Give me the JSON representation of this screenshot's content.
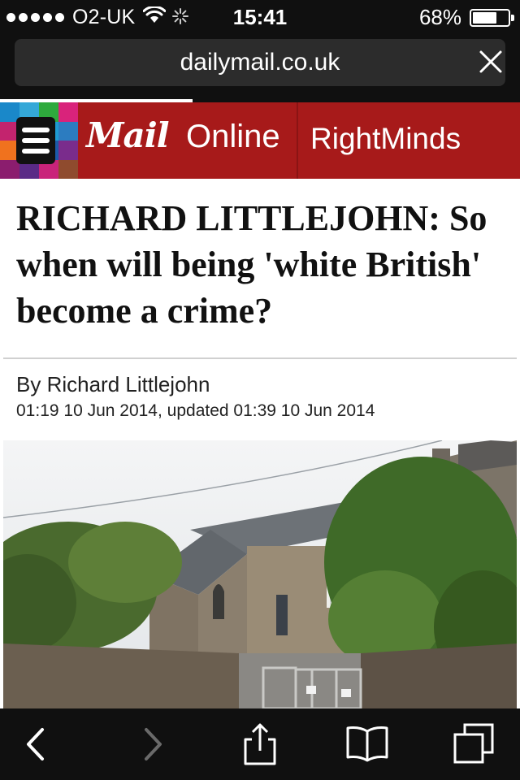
{
  "status_bar": {
    "carrier": "O2-UK",
    "time": "15:41",
    "battery": "68%",
    "battery_level": 0.68,
    "signal_bars": 5,
    "icons": [
      "signal-dots-icon",
      "wifi-icon",
      "activity-spinner-icon",
      "battery-icon"
    ]
  },
  "browser": {
    "url": "dailymail.co.uk",
    "load_progress": 0.37,
    "icons": [
      "close-icon"
    ]
  },
  "site_header": {
    "logo_mail": "Mail",
    "logo_online": "Online",
    "section": "RightMinds",
    "colors": {
      "brand_red": "#a71a1a"
    },
    "icons": [
      "menu-icon"
    ]
  },
  "article": {
    "headline": "RICHARD LITTLEJOHN: So when will being 'white British' become a crime?",
    "byline": "By Richard Littlejohn",
    "dateline": "01:19 10 Jun 2014, updated 01:39 10 Jun 2014"
  },
  "toolbar": {
    "icons": [
      "back-icon",
      "forward-icon",
      "share-icon",
      "bookmarks-icon",
      "tabs-icon"
    ]
  }
}
